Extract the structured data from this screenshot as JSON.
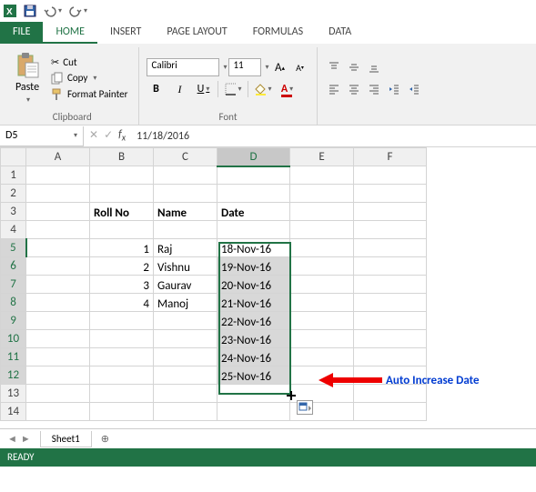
{
  "qat": {
    "excel": "X",
    "save": "💾"
  },
  "tabs": {
    "file": "FILE",
    "home": "HOME",
    "insert": "INSERT",
    "pageLayout": "PAGE LAYOUT",
    "formulas": "FORMULAS",
    "data": "DATA"
  },
  "ribbon": {
    "paste": "Paste",
    "cut": "Cut",
    "copy": "Copy",
    "formatPainter": "Format Painter",
    "clipboard": "Clipboard",
    "fontName": "Calibri",
    "fontSize": "11",
    "fontGroup": "Font",
    "bold": "B",
    "italic": "I",
    "underline": "U"
  },
  "namebox": "D5",
  "formula": "11/18/2016",
  "cols": [
    "A",
    "B",
    "C",
    "D",
    "E",
    "F"
  ],
  "rows": [
    "1",
    "2",
    "3",
    "4",
    "5",
    "6",
    "7",
    "8",
    "9",
    "10",
    "11",
    "12",
    "13",
    "14"
  ],
  "headers": {
    "rollNo": "Roll No",
    "name": "Name",
    "date": "Date"
  },
  "dataRows": [
    {
      "roll": "1",
      "name": "Raj",
      "date": "18-Nov-16"
    },
    {
      "roll": "2",
      "name": "Vishnu",
      "date": "19-Nov-16"
    },
    {
      "roll": "3",
      "name": "Gaurav",
      "date": "20-Nov-16"
    },
    {
      "roll": "4",
      "name": "Manoj",
      "date": "21-Nov-16"
    }
  ],
  "fillDates": [
    "22-Nov-16",
    "23-Nov-16",
    "24-Nov-16",
    "25-Nov-16"
  ],
  "annotation": "Auto Increase Date",
  "sheetTab": "Sheet1",
  "status": "READY"
}
